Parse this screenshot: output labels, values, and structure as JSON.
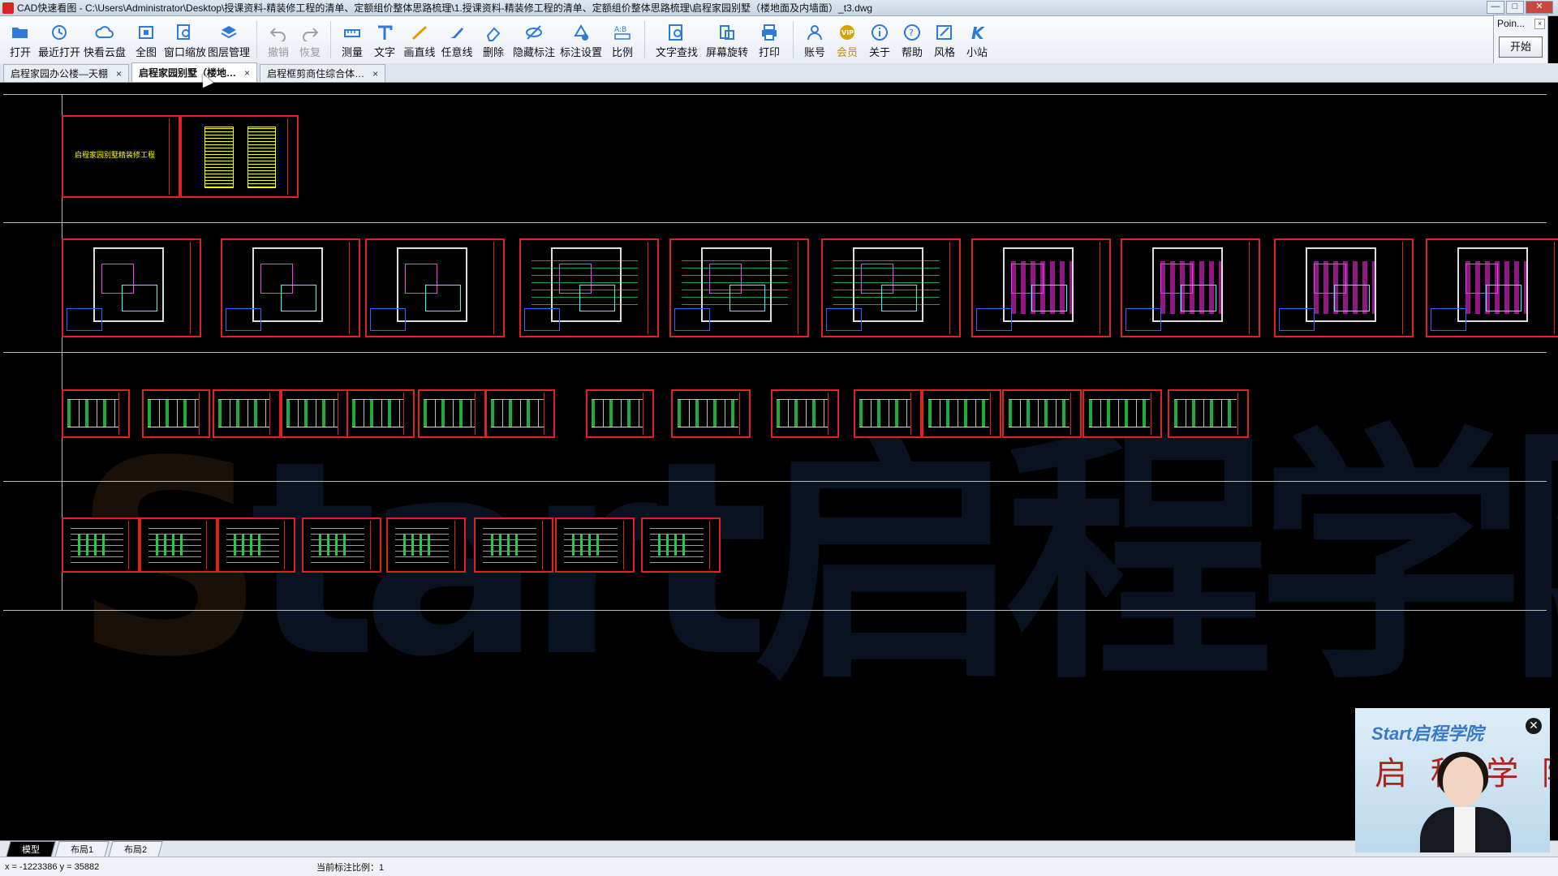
{
  "window": {
    "title": "CAD快速看图 - C:\\Users\\Administrator\\Desktop\\授课资料-精装修工程的清单、定额组价整体思路梳理\\1.授课资料-精装修工程的清单、定额组价整体思路梳理\\启程家园别墅（楼地面及内墙面）_t3.dwg",
    "controls": [
      "—",
      "□",
      "✕"
    ]
  },
  "toolbar": {
    "items": [
      {
        "label": "打开",
        "icon": "folder-open-icon",
        "color": "#2f7bd8"
      },
      {
        "label": "最近打开",
        "icon": "history-icon",
        "color": "#2f7bd8"
      },
      {
        "label": "快看云盘",
        "icon": "cloud-icon",
        "color": "#2f7bd8"
      },
      {
        "label": "全图",
        "icon": "fit-all-icon",
        "color": "#2f7bd8"
      },
      {
        "label": "窗口缩放",
        "icon": "zoom-window-icon",
        "color": "#2f7bd8"
      },
      {
        "label": "图层管理",
        "icon": "layers-icon",
        "color": "#2f7bd8"
      },
      {
        "label": "撤销",
        "icon": "undo-icon",
        "color": "#9aa3ad",
        "disabled": true
      },
      {
        "label": "恢复",
        "icon": "redo-icon",
        "color": "#9aa3ad",
        "disabled": true
      },
      {
        "label": "测量",
        "icon": "measure-icon",
        "color": "#2f7bd8"
      },
      {
        "label": "文字",
        "icon": "text-icon",
        "color": "#2f7bd8"
      },
      {
        "label": "画直线",
        "icon": "line-icon",
        "color": "#e0a000"
      },
      {
        "label": "任意线",
        "icon": "freehand-icon",
        "color": "#2f7bd8"
      },
      {
        "label": "删除",
        "icon": "eraser-icon",
        "color": "#2f7bd8"
      },
      {
        "label": "隐藏标注",
        "icon": "hide-annotation-icon",
        "color": "#2f7bd8"
      },
      {
        "label": "标注设置",
        "icon": "annotation-settings-icon",
        "color": "#2f7bd8"
      },
      {
        "label": "比例",
        "icon": "scale-icon",
        "color": "#2f7bd8"
      },
      {
        "label": "文字查找",
        "icon": "text-search-icon",
        "color": "#2f7bd8"
      },
      {
        "label": "屏幕旋转",
        "icon": "rotate-screen-icon",
        "color": "#2f7bd8"
      },
      {
        "label": "打印",
        "icon": "print-icon",
        "color": "#2f7bd8"
      },
      {
        "label": "账号",
        "icon": "account-icon",
        "color": "#2f7bd8"
      },
      {
        "label": "会员",
        "icon": "vip-icon",
        "color": "#d7a300"
      },
      {
        "label": "关于",
        "icon": "info-icon",
        "color": "#2f7bd8"
      },
      {
        "label": "帮助",
        "icon": "help-icon",
        "color": "#2f7bd8"
      },
      {
        "label": "风格",
        "icon": "style-icon",
        "color": "#2f7bd8"
      },
      {
        "label": "小站",
        "icon": "k-station-icon",
        "color": "#2f7bd8"
      }
    ]
  },
  "point_panel": {
    "title": "Poin...",
    "close": "×",
    "button": "开始"
  },
  "doc_tabs": [
    {
      "label": "启程家园办公楼—天棚",
      "active": false
    },
    {
      "label": "启程家园别墅（楼地…",
      "active": true
    },
    {
      "label": "启程框剪商住综合体…",
      "active": false
    }
  ],
  "canvas": {
    "watermark_mark": "S",
    "watermark_text": "tart启程学院",
    "cover_text": "启程家园别墅精装修工程"
  },
  "layout_tabs": [
    {
      "label": "模型",
      "active": true
    },
    {
      "label": "布局1",
      "active": false
    },
    {
      "label": "布局2",
      "active": false
    }
  ],
  "status": {
    "coords": "x = -1223386  y = 35882",
    "scale": "当前标注比例：1"
  },
  "webcam": {
    "brand": "Start启程学院",
    "calligraphy": "启 程 学 院",
    "close": "✕"
  }
}
